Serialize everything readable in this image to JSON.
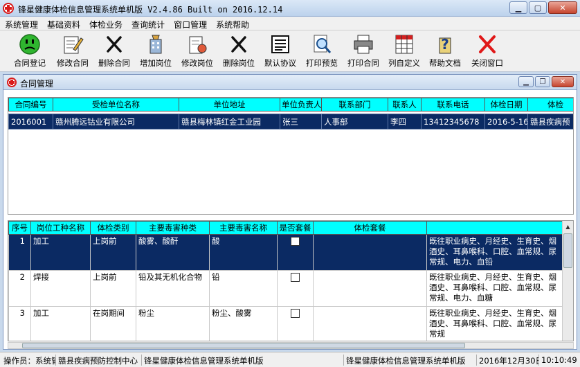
{
  "window": {
    "title": "锋星健康体检信息管理系统单机版 V2.4.86  Built on 2016.12.14"
  },
  "menu": [
    "系统管理",
    "基础资料",
    "体检业务",
    "查询统计",
    "窗口管理",
    "系统帮助"
  ],
  "toolbar": [
    {
      "label": "合同登记",
      "icon": "smiley-icon"
    },
    {
      "label": "修改合同",
      "icon": "edit-note-icon"
    },
    {
      "label": "删除合同",
      "icon": "delete-x-icon"
    },
    {
      "label": "增加岗位",
      "icon": "add-post-icon"
    },
    {
      "label": "修改岗位",
      "icon": "edit-post-icon"
    },
    {
      "label": "删除岗位",
      "icon": "delete-x-icon"
    },
    {
      "label": "默认协议",
      "icon": "document-icon"
    },
    {
      "label": "打印预览",
      "icon": "print-preview-icon"
    },
    {
      "label": "打印合同",
      "icon": "printer-icon"
    },
    {
      "label": "列自定义",
      "icon": "columns-icon"
    },
    {
      "label": "帮助文档",
      "icon": "help-icon"
    },
    {
      "label": "关闭窗口",
      "icon": "close-red-x-icon"
    }
  ],
  "child_window": {
    "title": "合同管理"
  },
  "contracts": {
    "headers": [
      "合同编号",
      "受检单位名称",
      "单位地址",
      "单位负责人",
      "联系部门",
      "联系人",
      "联系电话",
      "体检日期",
      "体检"
    ],
    "rows": [
      [
        "2016001",
        "赣州腾远钴业有限公司",
        "赣县梅林镇红金工业园",
        "张三",
        "人事部",
        "李四",
        "13412345678",
        "2016-5-16",
        "赣县疾病预"
      ]
    ]
  },
  "posts": {
    "headers": [
      "序号",
      "岗位工种名称",
      "体检类别",
      "主要毒害种类",
      "主要毒害名称",
      "是否套餐",
      "体检套餐",
      ""
    ],
    "rows": [
      {
        "no": "1",
        "name": "加工",
        "category": "上岗前",
        "hazard_type": "酸雾、酸酐",
        "hazard_name": "酸",
        "is_package": false,
        "package": "",
        "items": "既往职业病史、月经史、生育史、烟酒史、耳鼻喉科、口腔、血常规、尿常规、电力、血铅"
      },
      {
        "no": "2",
        "name": "焊接",
        "category": "上岗前",
        "hazard_type": "铅及其无机化合物",
        "hazard_name": "铅",
        "is_package": false,
        "package": "",
        "items": "既往职业病史、月经史、生育史、烟酒史、耳鼻喉科、口腔、血常规、尿常规、电力、血糖"
      },
      {
        "no": "3",
        "name": "加工",
        "category": "在岗期间",
        "hazard_type": "粉尘",
        "hazard_name": "粉尘、酸雾",
        "is_package": false,
        "package": "",
        "items": "既往职业病史、月经史、生育史、烟酒史、耳鼻喉科、口腔、血常规、尿常规"
      }
    ]
  },
  "status": {
    "operator": "操作员：系统管",
    "org": "赣县疾病预防控制中心",
    "app1": "锋星健康体检信息管理系统单机版",
    "app2": "锋星健康体检信息管理系统单机版",
    "date": "2016年12月30日",
    "time": "10:10:49"
  }
}
